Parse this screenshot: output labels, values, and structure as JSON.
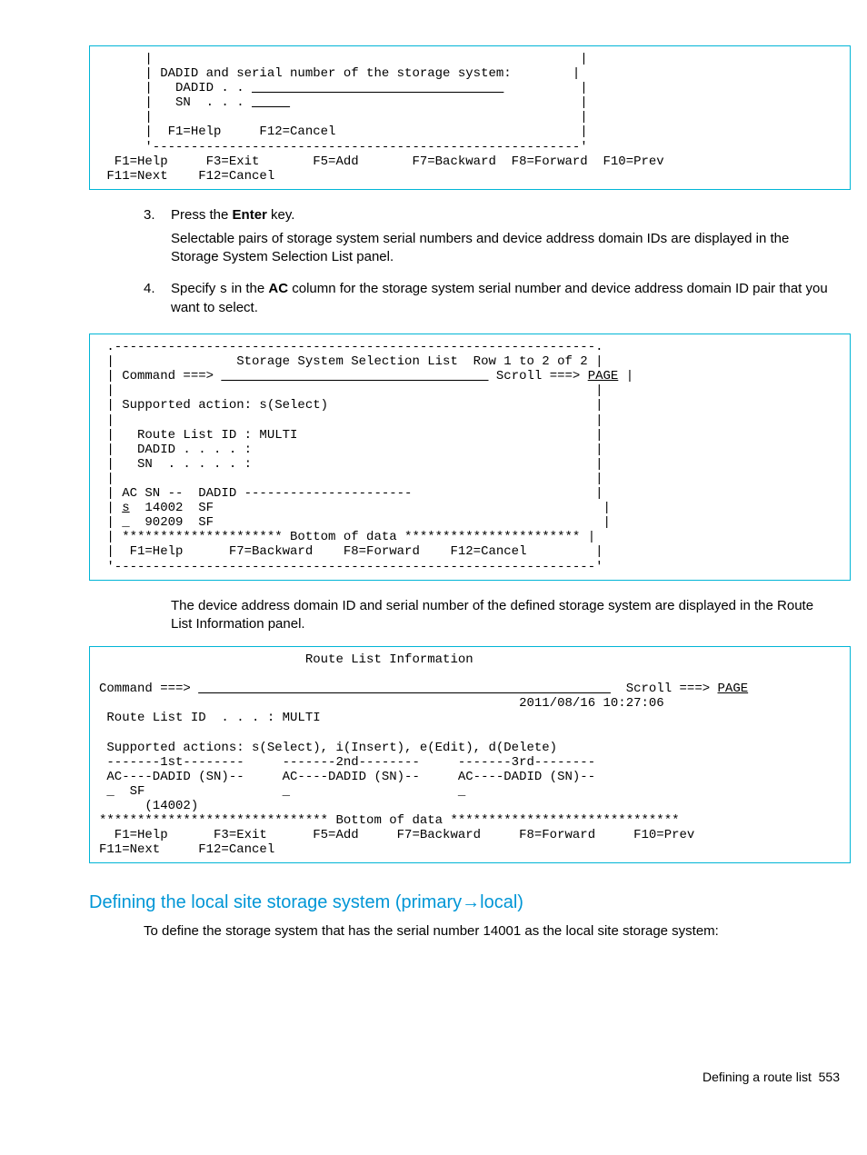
{
  "terminal1": {
    "l1": "      |                                                        |",
    "l2": "      | DADID and serial number of the storage system:        |",
    "l3a": "      |   DADID . . ",
    "l3b": "_________________________________",
    "l3c": "          |",
    "l4a": "      |   SN  . . . ",
    "l4b": "_____",
    "l4c": "                                      |",
    "l5": "      |                                                        |",
    "l6": "      |  F1=Help     F12=Cancel                                |",
    "l7": "      '--------------------------------------------------------'",
    "l8": "  F1=Help     F3=Exit       F5=Add       F7=Backward  F8=Forward  F10=Prev",
    "l9": " F11=Next    F12=Cancel"
  },
  "step3": {
    "num": "3.",
    "line1a": "Press the ",
    "line1b": "Enter",
    "line1c": " key.",
    "body": "Selectable pairs of storage system serial numbers and device address domain IDs are displayed in the Storage System Selection List panel."
  },
  "step4": {
    "num": "4.",
    "line1a": "Specify ",
    "line1b": "s",
    "line1c": " in the ",
    "line1d": "AC",
    "line1e": " column for the storage system serial number and device address domain ID pair that you want to select."
  },
  "terminal2": {
    "l1": " .---------------------------------------------------------------.",
    "l2": " |                Storage System Selection List  Row 1 to 2 of 2 |",
    "l3a": " | Command ===> ",
    "l3b": "___________________________________",
    "l3c": " Scroll ===> ",
    "l3d": "PAGE",
    "l3e": " |",
    "l4": " |                                                               |",
    "l5": " | Supported action: s(Select)                                   |",
    "l6": " |                                                               |",
    "l7": " |   Route List ID : MULTI                                       |",
    "l8": " |   DADID . . . . :                                             |",
    "l9": " |   SN  . . . . . :                                             |",
    "l10": " |                                                               |",
    "l11": " | AC SN --  DADID ----------------------                        |",
    "l12a": " | ",
    "l12b": "s",
    "l12c": "  14002  SF                                                   |",
    "l13": " | _  90209  SF                                                   |",
    "l14": " | ********************* Bottom of data *********************** |",
    "l15": " |  F1=Help      F7=Backward    F8=Forward    F12=Cancel         |",
    "l16": " '---------------------------------------------------------------'"
  },
  "after2": "The device address domain ID and serial number of the defined storage system are displayed in the Route List Information panel.",
  "terminal3": {
    "l1": "                           Route List Information",
    "l2": "",
    "l3a": "Command ===> ",
    "l3b": "______________________________________________________",
    "l3c": "  Scroll ===> ",
    "l3d": "PAGE",
    "l4": "                                                       2011/08/16 10:27:06",
    "l5": " Route List ID  . . . : MULTI",
    "l6": "",
    "l7": " Supported actions: s(Select), i(Insert), e(Edit), d(Delete)",
    "l8": " -------1st--------     -------2nd--------     -------3rd--------",
    "l9": " AC----DADID (SN)--     AC----DADID (SN)--     AC----DADID (SN)--",
    "l10": " _  SF                  _                      _",
    "l11": "      (14002)",
    "l12": "****************************** Bottom of data ******************************",
    "l13": "  F1=Help      F3=Exit      F5=Add     F7=Backward     F8=Forward     F10=Prev",
    "l14": "F11=Next     F12=Cancel"
  },
  "section_title": "Defining the local site storage system (primary→local)",
  "section_body": "To define the storage system that has the serial number 14001 as the local site storage system:",
  "footer_label": "Defining a route list",
  "footer_page": "553"
}
